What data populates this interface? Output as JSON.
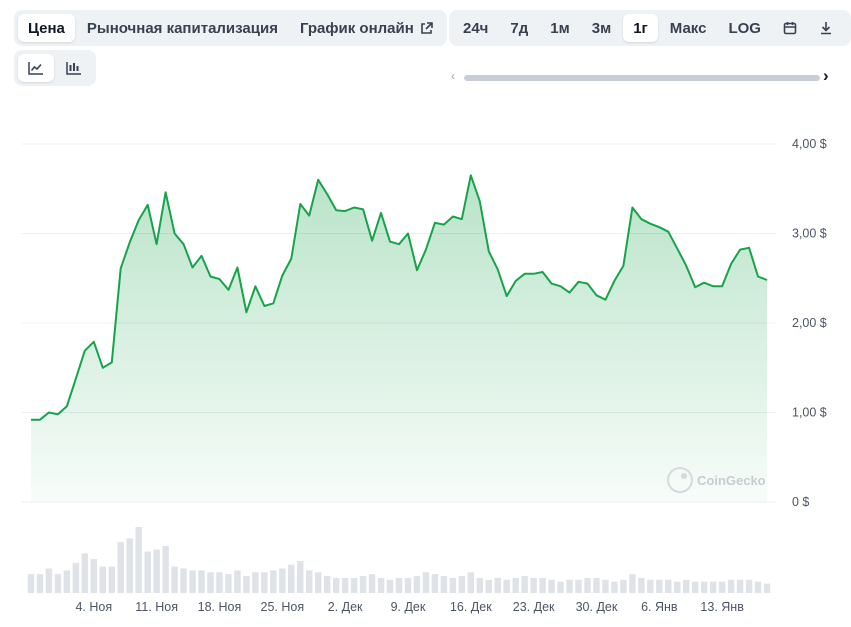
{
  "tabs": [
    {
      "label": "Цена",
      "active": true
    },
    {
      "label": "Рыночная капитализация",
      "active": false
    },
    {
      "label": "График онлайн",
      "active": false,
      "icon": "external-link-icon"
    }
  ],
  "ranges": [
    {
      "label": "24ч",
      "active": false
    },
    {
      "label": "7д",
      "active": false
    },
    {
      "label": "1м",
      "active": false
    },
    {
      "label": "3м",
      "active": false
    },
    {
      "label": "1г",
      "active": true
    },
    {
      "label": "Макс",
      "active": false
    },
    {
      "label": "LOG",
      "active": false
    },
    {
      "label": "",
      "icon": "calendar-icon",
      "active": false
    },
    {
      "label": "",
      "icon": "download-icon",
      "active": false
    }
  ],
  "chart_types": [
    {
      "icon": "line-chart-icon",
      "active": true
    },
    {
      "icon": "candlestick-chart-icon",
      "active": false
    }
  ],
  "scroll": {
    "left": "‹",
    "right": "›"
  },
  "watermark": "CoinGecko",
  "colors": {
    "line": "#16a34a",
    "volume": "#dfe3e8",
    "grid": "#eceff3"
  },
  "chart_data": {
    "type": "area",
    "title": "",
    "xlabel": "",
    "ylabel": "",
    "ylim": [
      0,
      4
    ],
    "y_ticks": [
      0,
      1,
      2,
      3,
      4
    ],
    "y_tick_labels": [
      "0 $",
      "1,00 $",
      "2,00 $",
      "3,00 $",
      "4,00 $"
    ],
    "x_tick_labels": [
      "4. Ноя",
      "11. Ноя",
      "18. Ноя",
      "25. Ноя",
      "2. Дек",
      "9. Дек",
      "16. Дек",
      "23. Дек",
      "30. Дек",
      "6. Янв",
      "13. Янв"
    ],
    "x_tick_days": [
      7,
      14,
      21,
      28,
      35,
      42,
      49,
      56,
      63,
      70,
      77
    ],
    "x_range_days": [
      -1,
      83
    ],
    "grid": true,
    "series": [
      {
        "x_days": [
          0,
          1,
          2,
          3,
          4,
          5,
          6,
          7,
          8,
          9,
          10,
          11,
          12,
          13,
          14,
          15,
          16,
          17,
          18,
          19,
          20,
          21,
          22,
          23,
          24,
          25,
          26,
          27,
          28,
          29,
          30,
          31,
          32,
          33,
          34,
          35,
          36,
          37,
          38,
          39,
          40,
          41,
          42,
          43,
          44,
          45,
          46,
          47,
          48,
          49,
          50,
          51,
          52,
          53,
          54,
          55,
          56,
          57,
          58,
          59,
          60,
          61,
          62,
          63,
          64,
          65,
          66,
          67,
          68,
          69,
          70,
          71,
          72,
          73,
          74,
          75,
          76,
          77,
          78,
          79,
          80,
          81,
          82
        ],
        "values": [
          0.92,
          0.92,
          1.0,
          0.98,
          1.07,
          1.38,
          1.69,
          1.79,
          1.5,
          1.56,
          2.61,
          2.9,
          3.15,
          3.32,
          2.88,
          3.46,
          3.0,
          2.88,
          2.62,
          2.75,
          2.52,
          2.49,
          2.37,
          2.62,
          2.12,
          2.41,
          2.19,
          2.22,
          2.53,
          2.72,
          3.33,
          3.2,
          3.6,
          3.44,
          3.26,
          3.25,
          3.29,
          3.27,
          2.92,
          3.23,
          2.91,
          2.88,
          3.0,
          2.59,
          2.82,
          3.12,
          3.1,
          3.19,
          3.16,
          3.65,
          3.36,
          2.8,
          2.6,
          2.3,
          2.47,
          2.55,
          2.55,
          2.57,
          2.44,
          2.41,
          2.34,
          2.46,
          2.44,
          2.31,
          2.26,
          2.47,
          2.64,
          3.29,
          3.16,
          3.11,
          3.07,
          3.02,
          2.83,
          2.64,
          2.4,
          2.45,
          2.41,
          2.41,
          2.66,
          2.82,
          2.84,
          2.52,
          2.48
        ]
      }
    ],
    "volume": [
      1.0,
      1.0,
      1.3,
      1.0,
      1.2,
      1.6,
      2.1,
      1.8,
      1.4,
      1.4,
      2.7,
      2.9,
      3.5,
      2.2,
      2.3,
      2.5,
      1.4,
      1.3,
      1.2,
      1.2,
      1.1,
      1.1,
      1.0,
      1.2,
      0.9,
      1.1,
      1.1,
      1.2,
      1.3,
      1.5,
      1.7,
      1.2,
      1.1,
      0.9,
      0.8,
      0.8,
      0.8,
      0.9,
      1.0,
      0.8,
      0.7,
      0.8,
      0.8,
      0.9,
      1.1,
      1.0,
      0.9,
      0.8,
      0.9,
      1.1,
      0.8,
      0.7,
      0.8,
      0.7,
      0.8,
      0.9,
      0.8,
      0.8,
      0.7,
      0.6,
      0.7,
      0.7,
      0.8,
      0.8,
      0.7,
      0.6,
      0.7,
      1.0,
      0.8,
      0.7,
      0.7,
      0.7,
      0.6,
      0.7,
      0.6,
      0.6,
      0.6,
      0.6,
      0.7,
      0.7,
      0.7,
      0.6,
      0.5
    ],
    "volume_max": 3.5
  }
}
